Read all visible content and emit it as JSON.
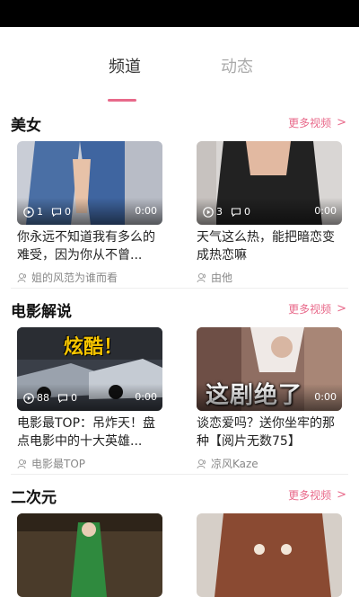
{
  "tabs": {
    "channels": "频道",
    "feed": "动态"
  },
  "sections": [
    {
      "title": "美女",
      "more": "更多视频",
      "cards": [
        {
          "title": "你永远不知道我有多么的难受，因为你从不曾...",
          "plays": "1",
          "comments": "0",
          "duration": "0:00",
          "author": "姐的风范为谁而看"
        },
        {
          "title": "天气这么热，能把暗恋变成热恋嘛",
          "plays": "3",
          "comments": "0",
          "duration": "0:00",
          "author": "由他"
        }
      ]
    },
    {
      "title": "电影解说",
      "more": "更多视频",
      "cards": [
        {
          "title": "电影最TOP：吊炸天！盘点电影中的十大英雄...",
          "plays": "88",
          "comments": "0",
          "duration": "0:00",
          "author": "电影最TOP",
          "banner": "炫酷！"
        },
        {
          "title": "谈恋爱吗？送你坐牢的那种【阅片无数75】",
          "plays": "",
          "comments": "",
          "duration": "0:00",
          "author": "凉风Kaze",
          "overlay": "这剧绝了"
        }
      ]
    },
    {
      "title": "二次元",
      "more": "更多视频",
      "cards": [
        {
          "title": "",
          "plays": "",
          "comments": "",
          "duration": "",
          "author": ""
        },
        {
          "title": "",
          "plays": "",
          "comments": "",
          "duration": "",
          "author": ""
        }
      ]
    }
  ],
  "icons": {
    "play": "play-circle-icon",
    "comment": "comment-bubble-icon",
    "user": "user-icon",
    "more": "chevron-right-icon"
  },
  "colors": {
    "accent": "#e8698a",
    "statusbar": "#000000"
  }
}
